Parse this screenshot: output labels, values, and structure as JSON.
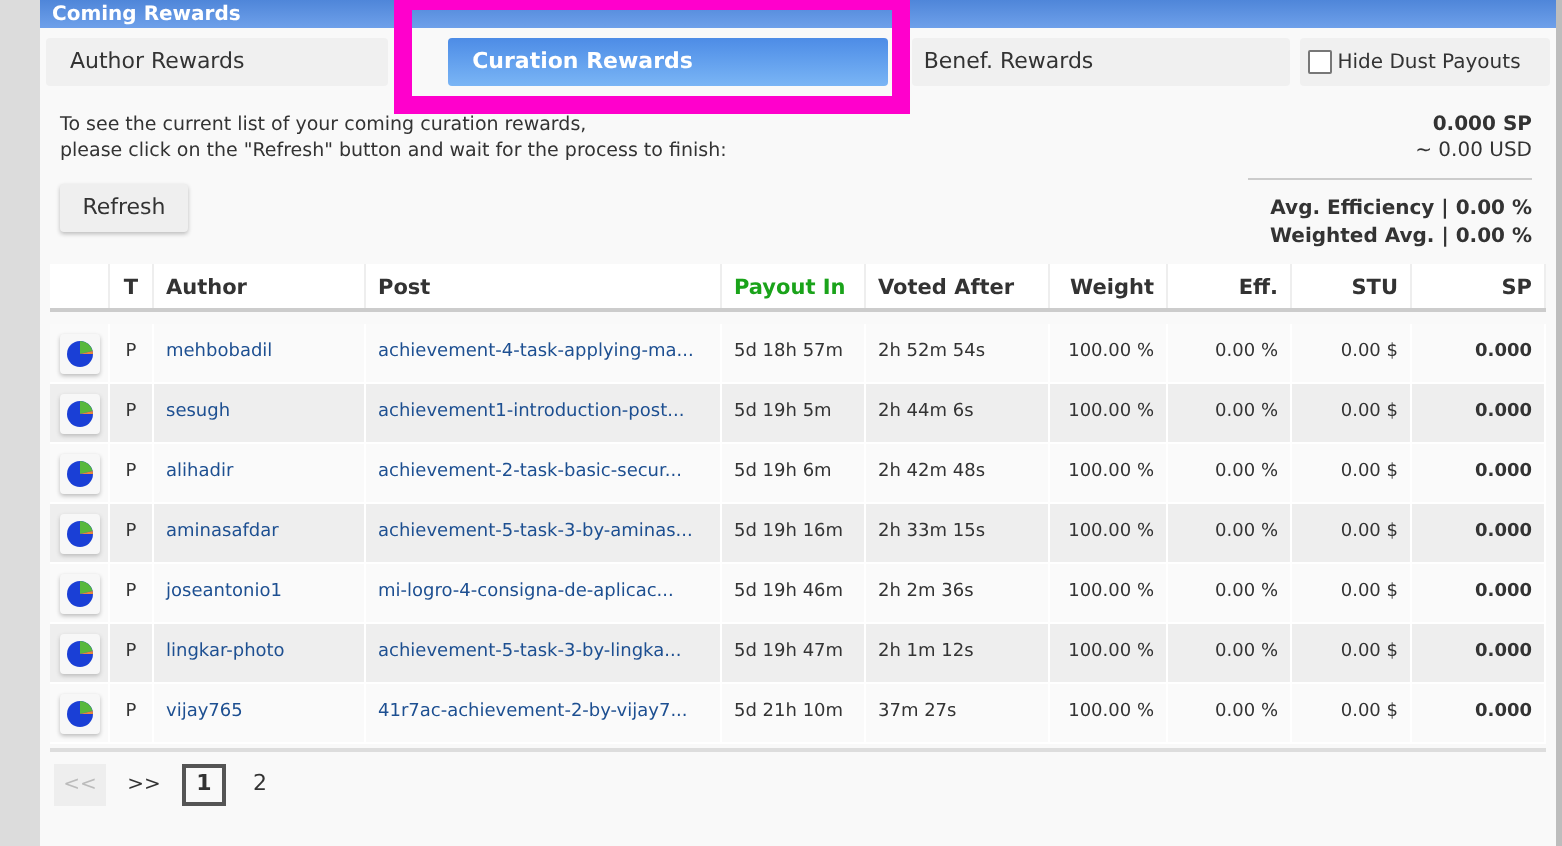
{
  "panel": {
    "title": "Coming Rewards"
  },
  "tabs": [
    {
      "label": "Author Rewards",
      "selected": false
    },
    {
      "label": "Curation Rewards",
      "selected": true
    },
    {
      "label": "Benef. Rewards",
      "selected": false
    }
  ],
  "hide_dust": {
    "label": "Hide Dust Payouts",
    "checked": false
  },
  "highlight": {
    "on": true
  },
  "intro": [
    "To see the current list of your coming curation rewards,",
    "please click on the \"Refresh\" button and wait for the process to finish:"
  ],
  "refresh_button": "Refresh",
  "totals": {
    "sp": "0.000 SP",
    "usd": "~ 0.00 USD"
  },
  "averages": [
    {
      "label": "Avg. Efficiency",
      "value": "| 0.00 %"
    },
    {
      "label": "Weighted Avg.",
      "value": "| 0.00 %"
    }
  ],
  "table": {
    "columns": [
      "T",
      "Author",
      "Post",
      "Payout In",
      "Voted After",
      "Weight",
      "Eff.",
      "STU",
      "SP"
    ],
    "rows": [
      {
        "t": "P",
        "author": "mehbobadil",
        "post": "achievement-4-task-applying-ma...",
        "payout_in": "5d 18h 57m",
        "voted_after": "2h 52m 54s",
        "weight": "100.00 %",
        "eff": "0.00 %",
        "stu": "0.00 $",
        "sp": "0.000"
      },
      {
        "t": "P",
        "author": "sesugh",
        "post": "achievement1-introduction-post...",
        "payout_in": "5d 19h 5m",
        "voted_after": "2h 44m 6s",
        "weight": "100.00 %",
        "eff": "0.00 %",
        "stu": "0.00 $",
        "sp": "0.000"
      },
      {
        "t": "P",
        "author": "alihadir",
        "post": "achievement-2-task-basic-secur...",
        "payout_in": "5d 19h 6m",
        "voted_after": "2h 42m 48s",
        "weight": "100.00 %",
        "eff": "0.00 %",
        "stu": "0.00 $",
        "sp": "0.000"
      },
      {
        "t": "P",
        "author": "aminasafdar",
        "post": "achievement-5-task-3-by-aminas...",
        "payout_in": "5d 19h 16m",
        "voted_after": "2h 33m 15s",
        "weight": "100.00 %",
        "eff": "0.00 %",
        "stu": "0.00 $",
        "sp": "0.000"
      },
      {
        "t": "P",
        "author": "joseantonio1",
        "post": "mi-logro-4-consigna-de-aplicac...",
        "payout_in": "5d 19h 46m",
        "voted_after": "2h 2m 36s",
        "weight": "100.00 %",
        "eff": "0.00 %",
        "stu": "0.00 $",
        "sp": "0.000"
      },
      {
        "t": "P",
        "author": "lingkar-photo",
        "post": "achievement-5-task-3-by-lingka...",
        "payout_in": "5d 19h 47m",
        "voted_after": "2h 1m 12s",
        "weight": "100.00 %",
        "eff": "0.00 %",
        "stu": "0.00 $",
        "sp": "0.000"
      },
      {
        "t": "P",
        "author": "vijay765",
        "post": "41r7ac-achievement-2-by-vijay7...",
        "payout_in": "5d 21h 10m",
        "voted_after": "37m 27s",
        "weight": "100.00 %",
        "eff": "0.00 %",
        "stu": "0.00 $",
        "sp": "0.000"
      }
    ]
  },
  "pagination": {
    "prev": {
      "label": "<<",
      "disabled": true
    },
    "next": {
      "label": ">>",
      "disabled": false
    },
    "pages": [
      {
        "label": "1",
        "selected": true
      },
      {
        "label": "2",
        "selected": false
      }
    ]
  }
}
